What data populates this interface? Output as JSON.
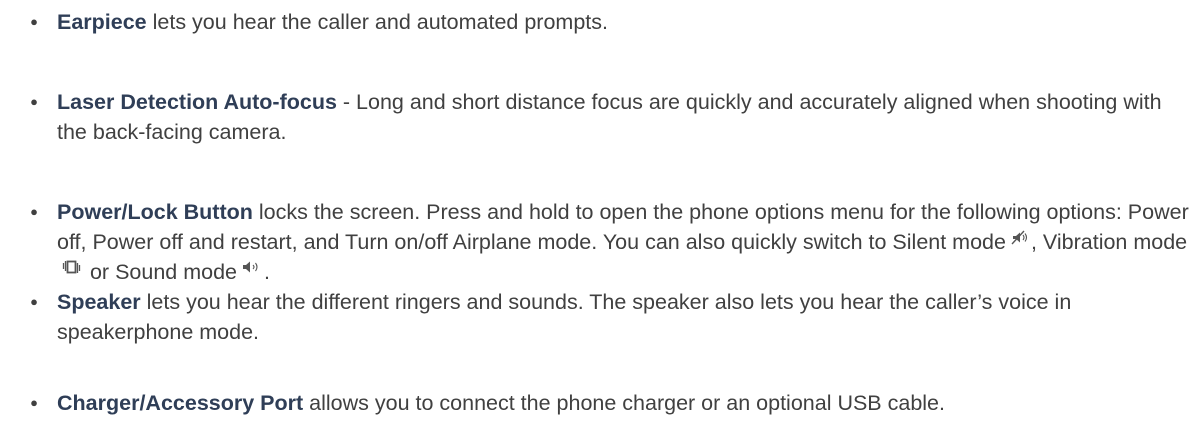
{
  "items": [
    {
      "term": "Earpiece",
      "text": " lets you hear the caller and automated prompts."
    },
    {
      "term": "Laser Detection Auto-focus",
      "text": " - Long and short distance focus are quickly and accurately aligned when shooting with the back-facing camera."
    },
    {
      "term": "Power/Lock Button",
      "text": " locks the screen. Press and hold to open the phone options menu for the following options: Power off, Power off and restart, and Turn on/off Airplane mode. You can also quickly switch to Silent mode",
      "text_after_silent": ", Vibration mode",
      "text_after_vibration": " or Sound mode",
      "text_end": "."
    },
    {
      "term": "Speaker",
      "text": " lets you hear the different ringers and sounds. The speaker also lets you hear the caller’s voice in speakerphone mode."
    },
    {
      "term": "Charger/Accessory Port",
      "text": " allows you to connect the phone charger or an optional USB cable."
    }
  ],
  "bullet": "●",
  "icons": {
    "silent": "silent-mode-icon",
    "vibration": "vibration-mode-icon",
    "sound": "sound-mode-icon"
  }
}
